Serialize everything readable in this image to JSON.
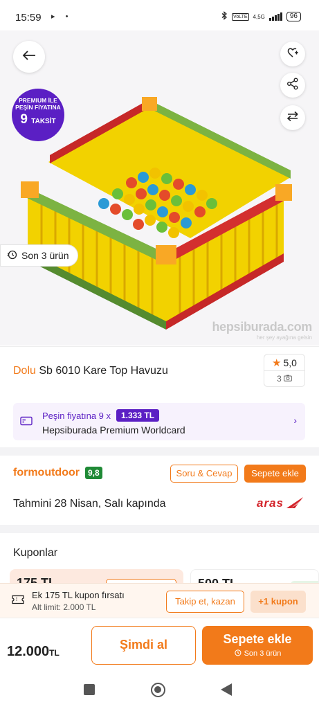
{
  "status_bar": {
    "time": "15:59",
    "left_glyphs": "▸ •",
    "net": "4,5G",
    "battery": "96"
  },
  "hero": {
    "badge_line1": "PREMIUM İLE",
    "badge_line2": "PEŞİN FİYATINA",
    "badge_line3": "9",
    "badge_line4": "TAKSİT",
    "stock": "Son 3 ürün",
    "watermark": "hepsiburada.com",
    "watermark_tag": "her şey ayağına gelsin"
  },
  "product": {
    "brand": "Dolu",
    "name": " Sb 6010 Kare Top Havuzu",
    "rating": "5,0",
    "photo_reviews": "3"
  },
  "premium": {
    "label": "Peşin fiyatına 9 x",
    "price": "1.333 TL",
    "card": "Hepsiburada Premium Worldcard"
  },
  "seller": {
    "name": "formoutdoor",
    "score": "9,8",
    "qa_button": "Soru & Cevap",
    "add_to_cart_button": "Sepete ekle",
    "delivery": "Tahmini 28 Nisan, Salı kapında",
    "carrier": "aras"
  },
  "coupons": {
    "title": "Kuponlar",
    "card1_amount": "175 TL",
    "card2_amount": "500 TL",
    "sticky_line1": "Ek 175 TL kupon fırsatı",
    "sticky_line2": "Alt limit: 2.000 TL",
    "follow_button": "Takip et, kazan",
    "plus_button": "+1 kupon"
  },
  "bottom": {
    "price": "12.000",
    "currency": "TL",
    "buy_now": "Şimdi al",
    "add_to_cart": "Sepete ekle",
    "stock_note": "Son 3 ürün"
  },
  "colors": {
    "accent": "#f27a1a",
    "premium": "#5b1fc4",
    "score": "#1f8a36"
  }
}
